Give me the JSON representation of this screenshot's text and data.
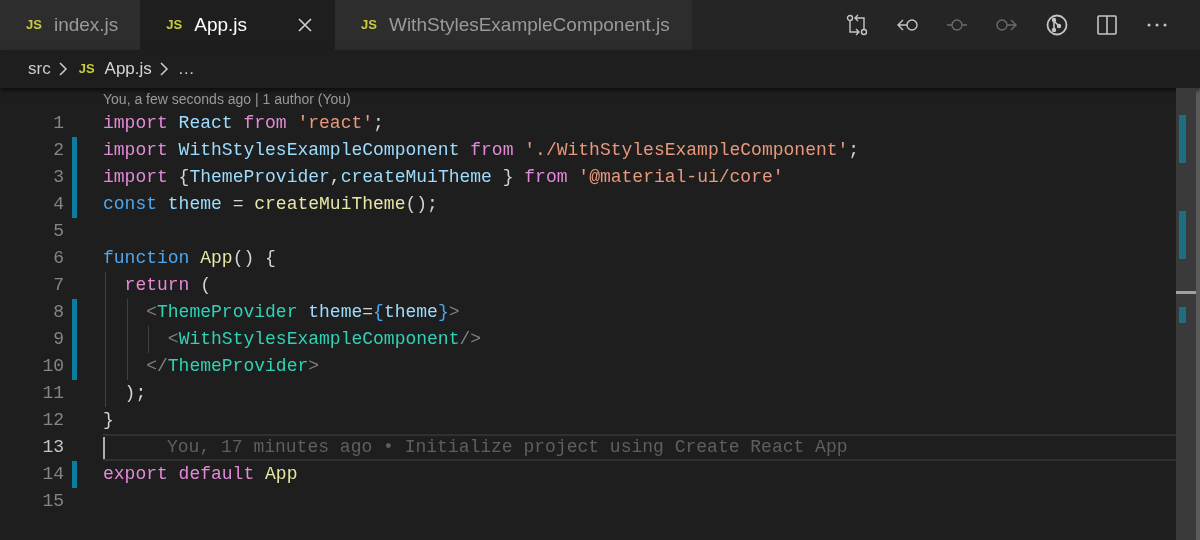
{
  "tabs": [
    {
      "icon_text": "JS",
      "label": "index.js",
      "selected": false
    },
    {
      "icon_text": "JS",
      "label": "App.js",
      "selected": true
    },
    {
      "icon_text": "JS",
      "label": "WithStylesExampleComponent.js",
      "selected": false
    }
  ],
  "toolbar": [
    {
      "kind": "compare",
      "disabled": false
    },
    {
      "kind": "previous-change",
      "disabled": false
    },
    {
      "kind": "commit",
      "disabled": true
    },
    {
      "kind": "next-change",
      "disabled": true
    },
    {
      "kind": "git-graph",
      "disabled": false
    },
    {
      "kind": "split",
      "disabled": false
    },
    {
      "kind": "more",
      "disabled": false
    }
  ],
  "breadcrumbs": [
    {
      "kind": "folder",
      "label": "src"
    },
    {
      "kind": "file",
      "icon_text": "JS",
      "label": "App.js"
    },
    {
      "kind": "symbol",
      "label": "…"
    }
  ],
  "codelens": "You, a few seconds ago | 1 author (You)",
  "lines": [
    {
      "number": "1",
      "modified": false,
      "current": false,
      "tokens": [
        {
          "kind": "keyword",
          "text": "import"
        },
        {
          "kind": "variable",
          "text": " React"
        },
        {
          "kind": "keyword",
          "text": " from"
        },
        {
          "kind": "string",
          "text": " 'react'"
        },
        {
          "kind": "plain",
          "text": ";"
        }
      ]
    },
    {
      "number": "2",
      "modified": true,
      "current": false,
      "tokens": [
        {
          "kind": "keyword",
          "text": "import"
        },
        {
          "kind": "variable",
          "text": " WithStylesExampleComponent"
        },
        {
          "kind": "keyword",
          "text": " from"
        },
        {
          "kind": "string",
          "text": " './WithStylesExampleComponent'"
        },
        {
          "kind": "plain",
          "text": ";"
        }
      ]
    },
    {
      "number": "3",
      "modified": true,
      "current": false,
      "tokens": [
        {
          "kind": "keyword",
          "text": "import"
        },
        {
          "kind": "plain",
          "text": " {"
        },
        {
          "kind": "variable",
          "text": "ThemeProvider"
        },
        {
          "kind": "plain",
          "text": ","
        },
        {
          "kind": "variable",
          "text": "createMuiTheme"
        },
        {
          "kind": "plain",
          "text": " }"
        },
        {
          "kind": "keyword",
          "text": " from"
        },
        {
          "kind": "string",
          "text": " '@material-ui/core'"
        }
      ]
    },
    {
      "number": "4",
      "modified": true,
      "current": false,
      "tokens": [
        {
          "kind": "storage",
          "text": "const"
        },
        {
          "kind": "variable",
          "text": " theme"
        },
        {
          "kind": "plain",
          "text": " ="
        },
        {
          "kind": "function",
          "text": " createMuiTheme"
        },
        {
          "kind": "plain",
          "text": "();"
        }
      ]
    },
    {
      "number": "5",
      "modified": false,
      "current": false
    },
    {
      "number": "6",
      "modified": false,
      "current": false,
      "tokens": [
        {
          "kind": "storage",
          "text": "function"
        },
        {
          "kind": "function",
          "text": " App"
        },
        {
          "kind": "plain",
          "text": "() {"
        }
      ]
    },
    {
      "number": "7",
      "modified": false,
      "current": false,
      "tokens": [
        {
          "kind": "keyword",
          "text": "  return"
        },
        {
          "kind": "plain",
          "text": " ("
        }
      ]
    },
    {
      "number": "8",
      "modified": true,
      "current": false,
      "tokens": [
        {
          "kind": "tag-punct",
          "text": "    <"
        },
        {
          "kind": "tag",
          "text": "ThemeProvider"
        },
        {
          "kind": "variable",
          "text": " theme"
        },
        {
          "kind": "plain",
          "text": "="
        },
        {
          "kind": "storage",
          "text": "{"
        },
        {
          "kind": "variable",
          "text": "theme"
        },
        {
          "kind": "storage",
          "text": "}"
        },
        {
          "kind": "tag-punct",
          "text": ">"
        }
      ]
    },
    {
      "number": "9",
      "modified": true,
      "current": false,
      "tokens": [
        {
          "kind": "tag-punct",
          "text": "      <"
        },
        {
          "kind": "tag",
          "text": "WithStylesExampleComponent"
        },
        {
          "kind": "tag-punct",
          "text": "/>"
        }
      ]
    },
    {
      "number": "10",
      "modified": true,
      "current": false,
      "tokens": [
        {
          "kind": "tag-punct",
          "text": "    </"
        },
        {
          "kind": "tag",
          "text": "ThemeProvider"
        },
        {
          "kind": "tag-punct",
          "text": ">"
        }
      ]
    },
    {
      "number": "11",
      "modified": false,
      "current": false,
      "tokens": [
        {
          "kind": "plain",
          "text": "  );"
        }
      ]
    },
    {
      "number": "12",
      "modified": false,
      "current": false,
      "tokens": [
        {
          "kind": "plain",
          "text": "}"
        }
      ]
    },
    {
      "number": "13",
      "modified": false,
      "current": true,
      "blame": "You, 17 minutes ago • Initialize project using Create React App"
    },
    {
      "number": "14",
      "modified": true,
      "current": false,
      "tokens": [
        {
          "kind": "keyword",
          "text": "export"
        },
        {
          "kind": "keyword",
          "text": " default"
        },
        {
          "kind": "function",
          "text": " App"
        }
      ]
    },
    {
      "number": "15",
      "modified": false,
      "current": false
    }
  ]
}
